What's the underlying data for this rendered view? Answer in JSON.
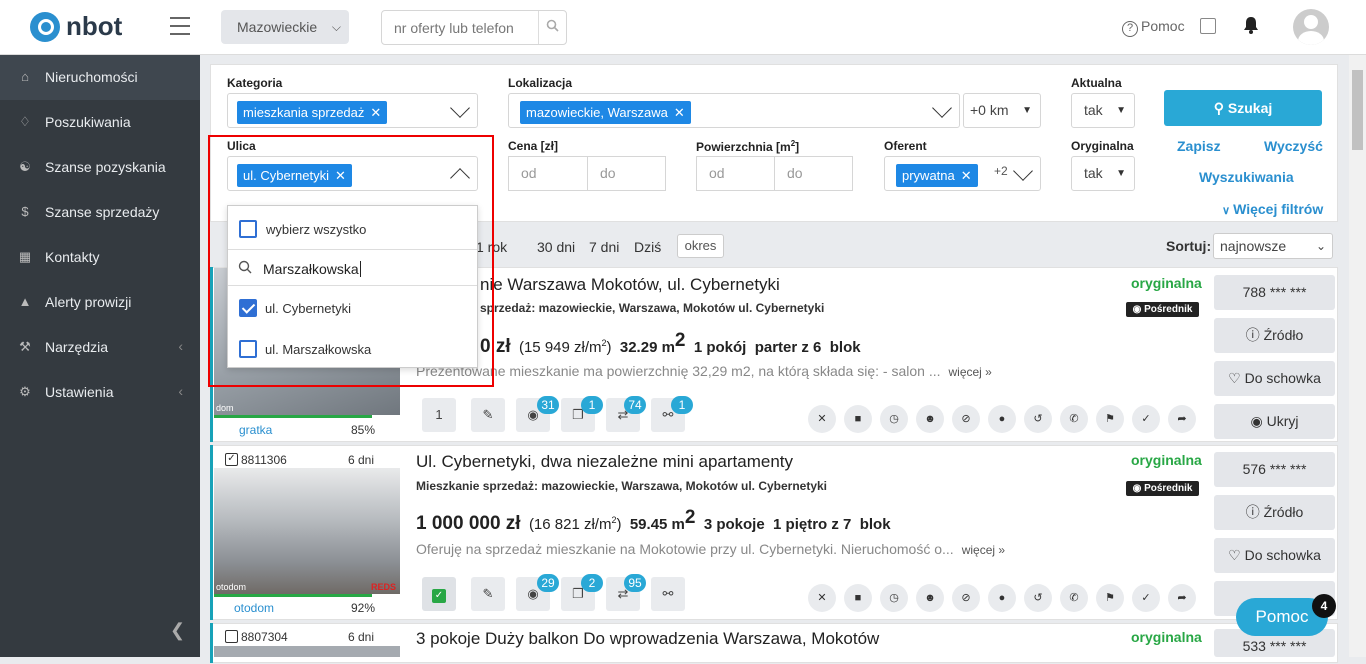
{
  "header": {
    "logo_text": "nbot",
    "region": "Mazowieckie",
    "search_placeholder": "nr oferty lub telefon",
    "help": "Pomoc"
  },
  "sidebar": {
    "items": [
      {
        "label": "Nieruchomości",
        "icon": "home-icon"
      },
      {
        "label": "Poszukiwania",
        "icon": "bell-outline-icon"
      },
      {
        "label": "Szanse pozyskania",
        "icon": "handshake-icon"
      },
      {
        "label": "Szanse sprzedaży",
        "icon": "dollar-icon"
      },
      {
        "label": "Kontakty",
        "icon": "contacts-icon"
      },
      {
        "label": "Alerty prowizji",
        "icon": "warning-icon"
      },
      {
        "label": "Narzędzia",
        "icon": "wrench-icon"
      },
      {
        "label": "Ustawienia",
        "icon": "gear-icon"
      }
    ]
  },
  "filters": {
    "kategoria_label": "Kategoria",
    "kategoria_tag": "mieszkania sprzedaż",
    "lokalizacja_label": "Lokalizacja",
    "lokalizacja_tag": "mazowieckie, Warszawa",
    "km": "+0 km",
    "aktualna_label": "Aktualna",
    "aktualna_value": "tak",
    "szukaj": "Szukaj",
    "ulica_label": "Ulica",
    "ulica_tag": "ul. Cybernetyki",
    "cena_label": "Cena [zł]",
    "cena_od": "od",
    "cena_do": "do",
    "powierzchnia_label": "Powierzchnia [m",
    "powierzchnia_sup": "2",
    "powierzchnia_close": "]",
    "pow_od": "od",
    "pow_do": "do",
    "oferent_label": "Oferent",
    "oferent_tag": "prywatna",
    "oferent_more": "+2",
    "oryginalna_label": "Oryginalna",
    "oryginalna_value": "tak",
    "zapisz": "Zapisz",
    "wyczysc": "Wyczyść",
    "wyszukiwania": "Wyszukiwania",
    "wiecej_filtrow": "Więcej filtrów"
  },
  "dropdown": {
    "select_all": "wybierz wszystko",
    "search_value": "Marszałkowska",
    "options": [
      "ul. Cybernetyki",
      "ul. Marszałkowska"
    ]
  },
  "period": {
    "options": [
      "1 rok",
      "30 dni",
      "7 dni",
      "Dziś"
    ],
    "okres": "okres",
    "sort_label": "Sortuj:",
    "sort_value": "najnowsze"
  },
  "listings": [
    {
      "title": "nie Warszawa Mokotów, ul. Cybernetyki",
      "subtitle": "sprzedaż: mazowieckie, Warszawa, Mokotów ul. Cybernetyki",
      "price": "0 zł",
      "per_m2": "(15 949 zł/m",
      "area": "32.29 m",
      "rooms": "1 pokój",
      "floor": "parter z 6",
      "type": "blok",
      "desc": "Prezentowane mieszkanie ma powierzchnię 32,29 m2, na którą składa się: - salon ...",
      "more": "więcej »",
      "orig": "oryginalna",
      "agent": "Pośrednik",
      "phone": "788 *** ***",
      "src_btn": "Źródło",
      "fav_btn": "Do schowka",
      "hide_btn": "Ukryj",
      "count_box": "1",
      "badges": [
        "31",
        "1",
        "74",
        "1"
      ],
      "source": "gratka",
      "pct": "85%",
      "watermark": "dom"
    },
    {
      "id": "8811306",
      "days": "6 dni",
      "title": "Ul. Cybernetyki, dwa niezależne mini apartamenty",
      "subtitle": "Mieszkanie sprzedaż: mazowieckie, Warszawa, Mokotów ul. Cybernetyki",
      "price": "1 000 000 zł",
      "per_m2": "(16 821 zł/m",
      "area": "59.45 m",
      "rooms": "3 pokoje",
      "floor": "1 piętro z 7",
      "type": "blok",
      "desc": "Oferuję na sprzedaż mieszkanie na Mokotowie przy ul. Cybernetyki. Nieruchomość o...",
      "more": "więcej »",
      "orig": "oryginalna",
      "agent": "Pośrednik",
      "phone": "576 *** ***",
      "src_btn": "Źródło",
      "fav_btn": "Do schowka",
      "badges": [
        "29",
        "2",
        "95"
      ],
      "source": "otodom",
      "pct": "92%",
      "watermark": "otodom",
      "brand": "REDS"
    },
    {
      "id": "8807304",
      "days": "6 dni",
      "title": "3 pokoje Duży balkon Do wprowadzenia Warszawa, Mokotów",
      "orig": "oryginalna",
      "phone": "533 *** ***"
    }
  ],
  "pomoc": {
    "label": "Pomoc",
    "count": "4"
  },
  "colors": {
    "accent": "#29a8d6",
    "tag": "#1e88e5",
    "green": "#28a745",
    "sidebar": "#343a40",
    "highlight": "#e00000"
  }
}
